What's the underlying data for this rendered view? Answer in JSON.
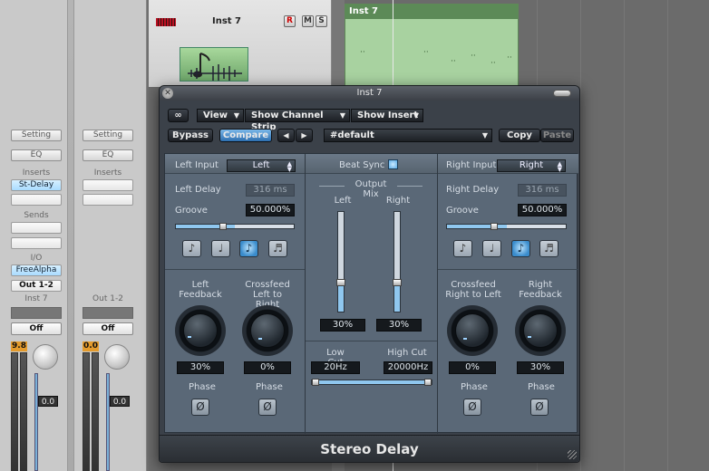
{
  "mixer": {
    "strip1": {
      "setting": "Setting",
      "eq": "EQ",
      "inserts_label": "Inserts",
      "insert1": "St-Delay",
      "sends_label": "Sends",
      "io_label": "I/O",
      "input": "FreeAlpha",
      "output": "Out 1-2",
      "name": "Inst 7",
      "automation": "Off",
      "peak": "9.8",
      "volume": "0.0"
    },
    "strip2": {
      "setting": "Setting",
      "eq": "EQ",
      "inserts_label": "Inserts",
      "name": "Out 1-2",
      "automation": "Off",
      "peak": "0.0",
      "volume": "0.0"
    }
  },
  "arrange": {
    "track_name": "Inst 7",
    "record": "R",
    "mute": "M",
    "solo": "S",
    "region_name": "Inst 7",
    "note_glyphs": "··"
  },
  "plugin": {
    "window_title": "Inst 7",
    "link_icon": "∞",
    "menus": {
      "view": "View",
      "show_channel_strip": "Show Channel Strip",
      "show_insert": "Show Insert"
    },
    "bypass": "Bypass",
    "compare": "Compare",
    "prev": "◀",
    "next": "▶",
    "preset": "#default",
    "copy": "Copy",
    "paste": "Paste",
    "left": {
      "input_label": "Left Input",
      "input_value": "Left",
      "delay_label": "Left Delay",
      "delay_value": "316 ms",
      "groove_label": "Groove",
      "groove_value": "50.000%",
      "feedback_label": "Left Feedback",
      "feedback_value": "30%",
      "crossfeed_label": "Crossfeed Left to Right",
      "crossfeed_value": "0%",
      "phase_label": "Phase"
    },
    "center": {
      "beat_sync_label": "Beat Sync",
      "output_mix_label": "Output Mix",
      "left_label": "Left",
      "right_label": "Right",
      "left_value": "30%",
      "right_value": "30%",
      "low_cut_label": "Low Cut",
      "high_cut_label": "High Cut",
      "low_cut_value": "20Hz",
      "high_cut_value": "20000Hz"
    },
    "right": {
      "input_label": "Right Input",
      "input_value": "Right",
      "delay_label": "Right Delay",
      "delay_value": "316 ms",
      "groove_label": "Groove",
      "groove_value": "50.000%",
      "crossfeed_label": "Crossfeed Right to Left",
      "crossfeed_value": "0%",
      "feedback_label": "Right Feedback",
      "feedback_value": "30%",
      "phase_label": "Phase"
    },
    "note_glyphs": {
      "half": "♪",
      "quarter": "♩",
      "eighth": "♪",
      "sixteenth": "♬"
    },
    "phase_glyph": "Ø",
    "footer": "Stereo Delay"
  },
  "colors": {
    "accent_blue": "#8fc7ef",
    "panel": "#5a6877",
    "region_green": "#a8d2a0"
  }
}
